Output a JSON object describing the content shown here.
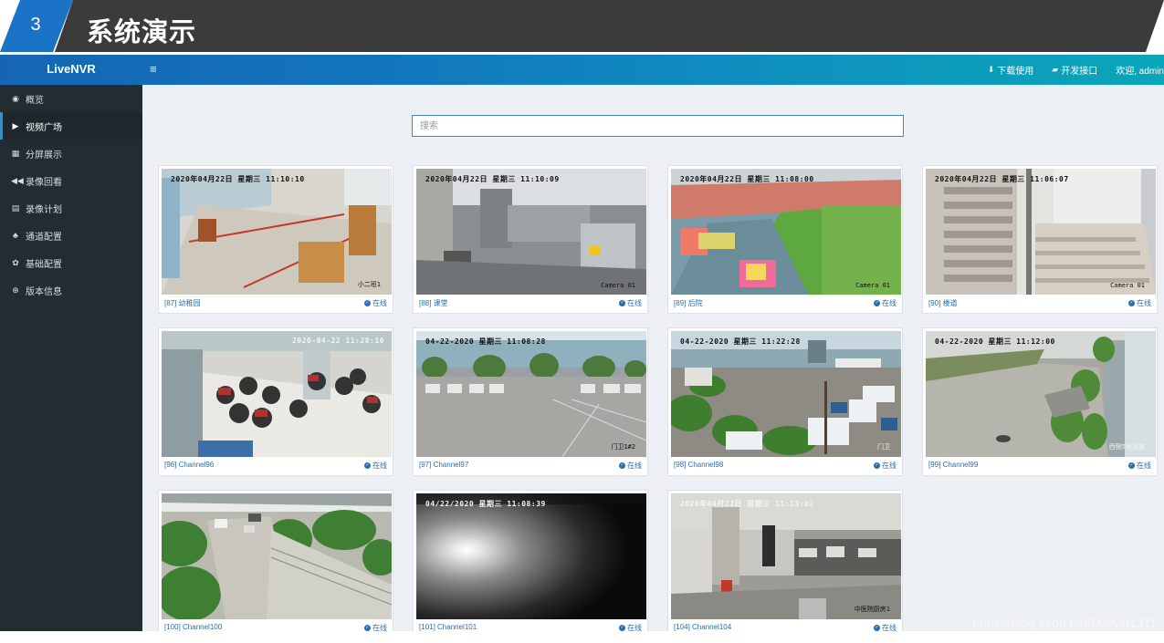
{
  "banner": {
    "number": "3",
    "title": "系统演示"
  },
  "header": {
    "logo": "LiveNVR",
    "menu_icon": "≡",
    "links": [
      {
        "icon": "download-icon",
        "glyph": "⬇",
        "label": "下载使用"
      },
      {
        "icon": "book-icon",
        "glyph": "▰",
        "label": "开发接口"
      }
    ],
    "user": "欢迎, admin"
  },
  "sidebar": {
    "items": [
      {
        "icon": "dashboard-icon",
        "glyph": "◉",
        "label": "概览"
      },
      {
        "icon": "play-icon",
        "glyph": "▶",
        "label": "视频广场",
        "active": true
      },
      {
        "icon": "grid-icon",
        "glyph": "▦",
        "label": "分屏展示"
      },
      {
        "icon": "rewind-icon",
        "glyph": "◀◀",
        "label": "录像回看"
      },
      {
        "icon": "calendar-icon",
        "glyph": "▤",
        "label": "录像计划"
      },
      {
        "icon": "sitemap-icon",
        "glyph": "♣",
        "label": "通道配置"
      },
      {
        "icon": "gear-icon",
        "glyph": "✿",
        "label": "基础配置"
      },
      {
        "icon": "lifebuoy-icon",
        "glyph": "⊕",
        "label": "版本信息"
      }
    ]
  },
  "search": {
    "placeholder": "搜索"
  },
  "status_label": "在线",
  "cards": [
    {
      "caption": "[87] 幼稚园",
      "osd": "2020年04月22日  星期三  11:10:10",
      "osd2": "小二班1",
      "scene": "classroom"
    },
    {
      "caption": "[88] 课堂",
      "osd": "2020年04月22日  星期三  11:10:09",
      "osd2": "Camera 01",
      "scene": "kitchen"
    },
    {
      "caption": "[89] 后院",
      "osd": "2020年04月22日  星期三  11:08:00",
      "osd2": "Camera 01",
      "scene": "yard"
    },
    {
      "caption": "[90] 楼道",
      "osd": "2020年04月22日  星期三  11:06:07",
      "osd2": "Camera 01",
      "scene": "stairs"
    },
    {
      "caption": "[96] Channel96",
      "osd": "2020-04-22 11:28:10",
      "osd2": "",
      "scene": "parking",
      "osd_right": true,
      "osd_light": true
    },
    {
      "caption": "[97] Channel97",
      "osd": "04-22-2020  星期三  11:08:28",
      "osd2": "门卫1#2",
      "scene": "lot"
    },
    {
      "caption": "[98] Channel98",
      "osd": "04-22-2020  星期三  11:22:28",
      "osd2": "门卫",
      "scene": "port",
      "osd2_light": true
    },
    {
      "caption": "[99] Channel99",
      "osd": "04-22-2020  星期三  11:12:00",
      "osd2": "西侧5号通道",
      "scene": "alley",
      "osd2_light": true
    },
    {
      "caption": "[100] Channel100",
      "osd": "",
      "osd2": "",
      "scene": "road"
    },
    {
      "caption": "[101] Channel101",
      "osd": "04/22/2020  星期三  11:08:39",
      "osd2": "",
      "scene": "dark",
      "osd_light": true
    },
    {
      "caption": "[104] Channel104",
      "osd": "2020年04月22日  星期三  11:13:02",
      "osd2": "中医院厨房1",
      "scene": "backkitchen",
      "osd_light": true
    }
  ],
  "watermark": "https://blog.csdn.net/Marvin1311"
}
